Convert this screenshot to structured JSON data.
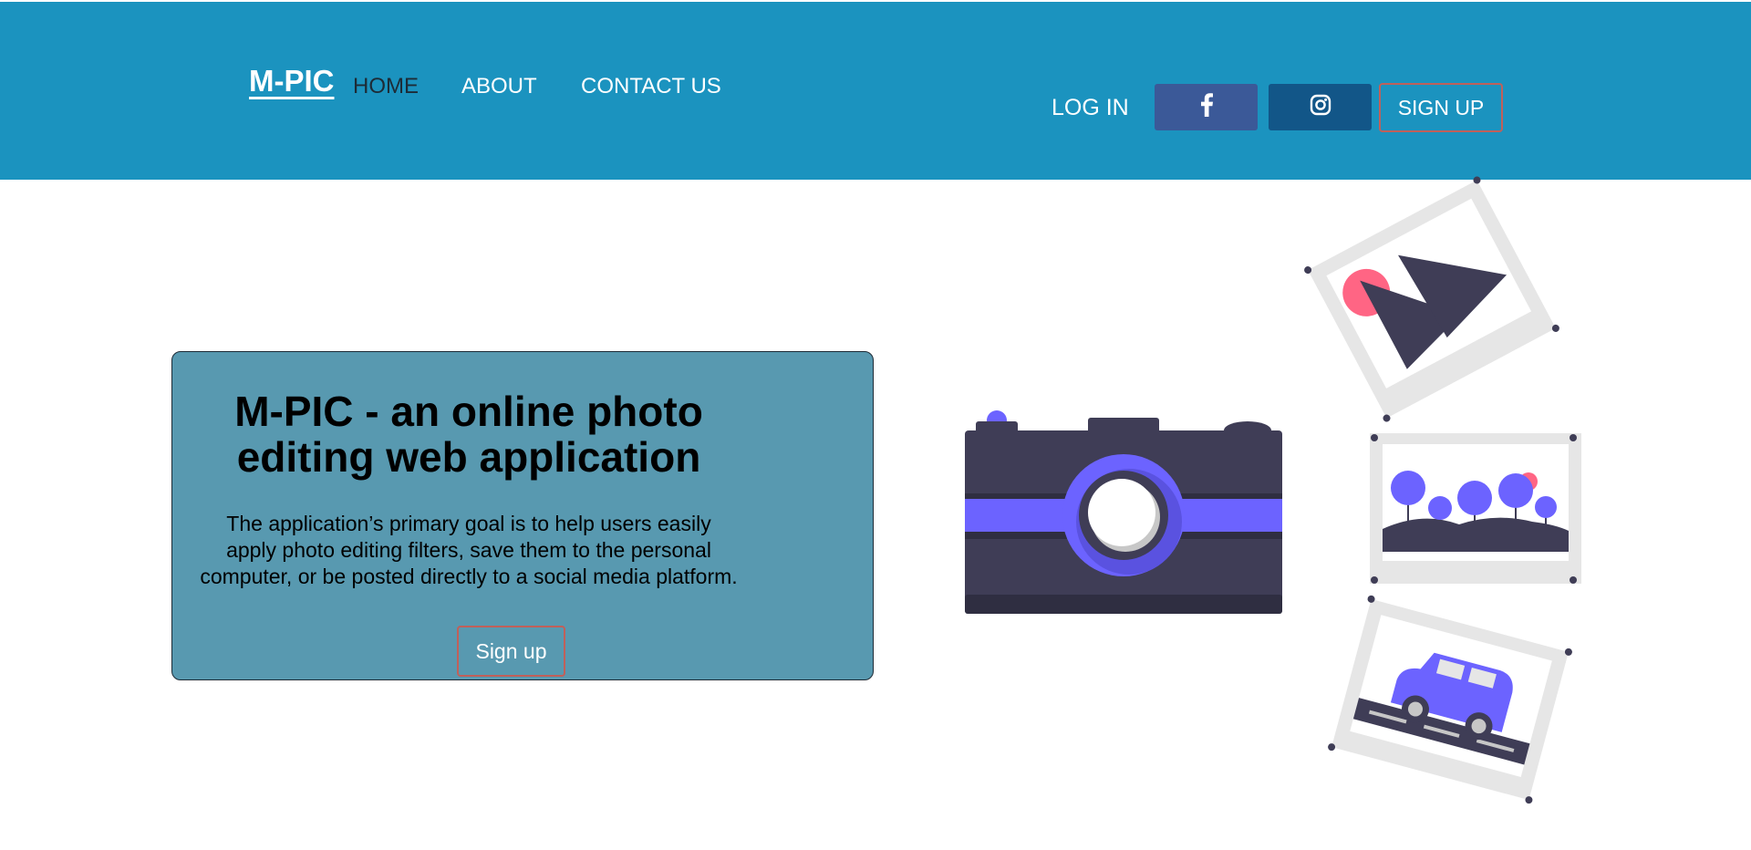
{
  "navbar": {
    "brand": "M-PIC",
    "links": [
      {
        "label": "HOME",
        "active": true
      },
      {
        "label": "ABOUT",
        "active": false
      },
      {
        "label": "CONTACT US",
        "active": false
      }
    ],
    "login_label": "LOG IN",
    "social": [
      {
        "icon": "facebook-icon",
        "color": "#3b5998"
      },
      {
        "icon": "instagram-icon",
        "color": "#125688"
      }
    ],
    "signup_label": "SIGN UP"
  },
  "hero": {
    "title": "M-PIC - an online photo editing web application",
    "description": "The application’s primary goal is to help users easily apply photo editing filters, save them to the personal computer, or be posted directly to a social media platform.",
    "button_label": "Sign up"
  },
  "illustration": {
    "name": "camera-and-photos-illustration",
    "accent": "#6c63ff",
    "dark": "#3f3d56",
    "pink": "#ff6584"
  },
  "colors": {
    "navbar_bg": "#1b93bf",
    "card_bg": "#5899b0",
    "button_border": "#c0605a"
  }
}
